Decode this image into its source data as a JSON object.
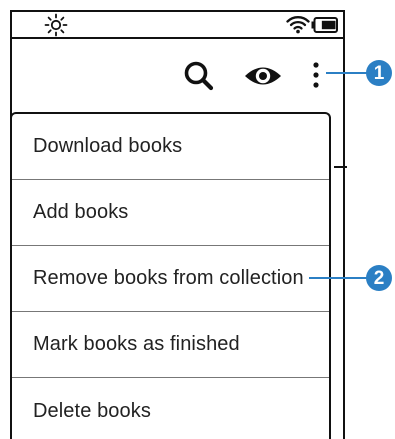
{
  "statusbar": {
    "brightness_icon": "brightness-icon",
    "wifi_icon": "wifi-icon",
    "battery_icon": "battery-icon",
    "battery_level": 0.7
  },
  "toolbar": {
    "search_icon": "search-icon",
    "eye_icon": "eye-icon",
    "more_icon": "more-vertical-icon"
  },
  "menu": {
    "items": [
      {
        "label": "Download books"
      },
      {
        "label": "Add books"
      },
      {
        "label": "Remove books from collection"
      },
      {
        "label": "Mark books as finished"
      },
      {
        "label": "Delete books"
      }
    ]
  },
  "callouts": [
    {
      "number": "1",
      "target": "more-vertical-icon"
    },
    {
      "number": "2",
      "target": "Remove books from collection"
    }
  ],
  "colors": {
    "callout": "#2b7fc4",
    "ink": "#111111"
  }
}
